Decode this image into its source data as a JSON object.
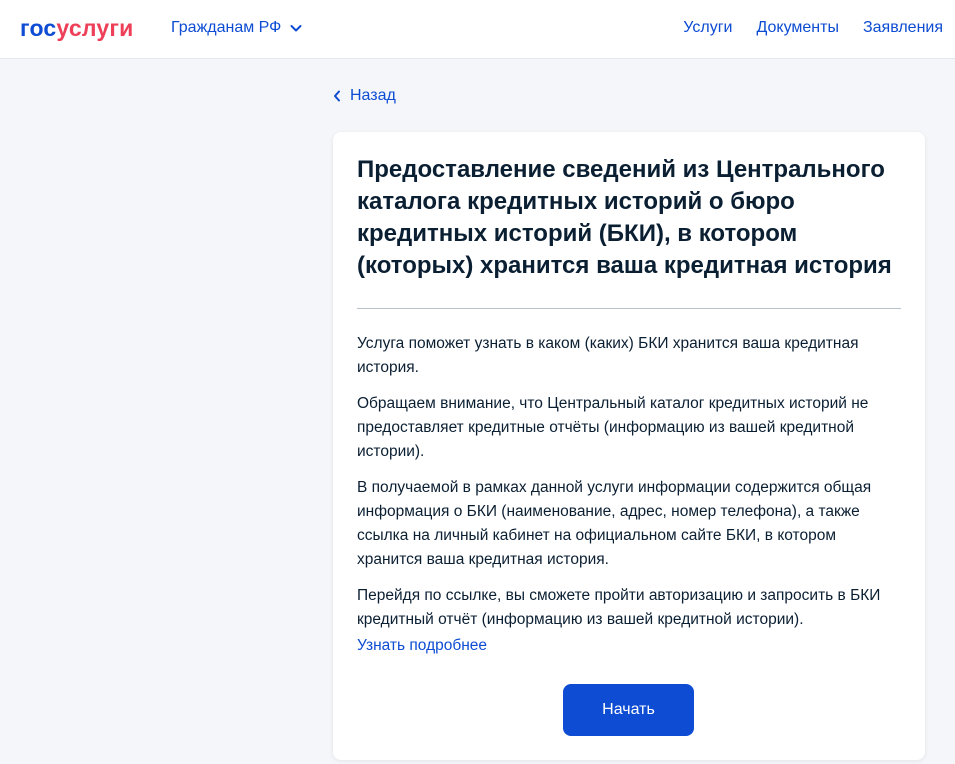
{
  "header": {
    "logo": {
      "part1": "гос",
      "part2": "услуги"
    },
    "region_label": "Гражданам РФ",
    "nav": [
      "Услуги",
      "Документы",
      "Заявления"
    ]
  },
  "back_label": "Назад",
  "card": {
    "title": "Предоставление сведений из Центрального каталога кредитных историй о бюро кредитных историй (БКИ), в котором (которых) хранится ваша кредитная история",
    "paragraphs": [
      "Услуга поможет узнать в каком (каких) БКИ хранится ваша кредитная история.",
      "Обращаем внимание, что Центральный каталог кредитных историй не предоставляет кредитные отчёты (информацию из вашей кредитной истории).",
      "В получаемой в рамках данной услуги информации содержится общая информация о БКИ (наименование, адрес, номер телефона), а также ссылка на личный кабинет на официальном сайте БКИ, в котором хранится ваша кредитная история.",
      "Перейдя по ссылке, вы сможете пройти авторизацию и запросить в БКИ кредитный отчёт (информацию из вашей кредитной истории)."
    ],
    "more_link": "Узнать подробнее",
    "start_button": "Начать"
  },
  "icons": {
    "region_dropdown": "chevron-down-icon",
    "back": "chevron-left-icon"
  },
  "colors": {
    "brand_blue": "#0d4cd3",
    "brand_red": "#ee3f58",
    "page_background": "#f4f6f9"
  }
}
